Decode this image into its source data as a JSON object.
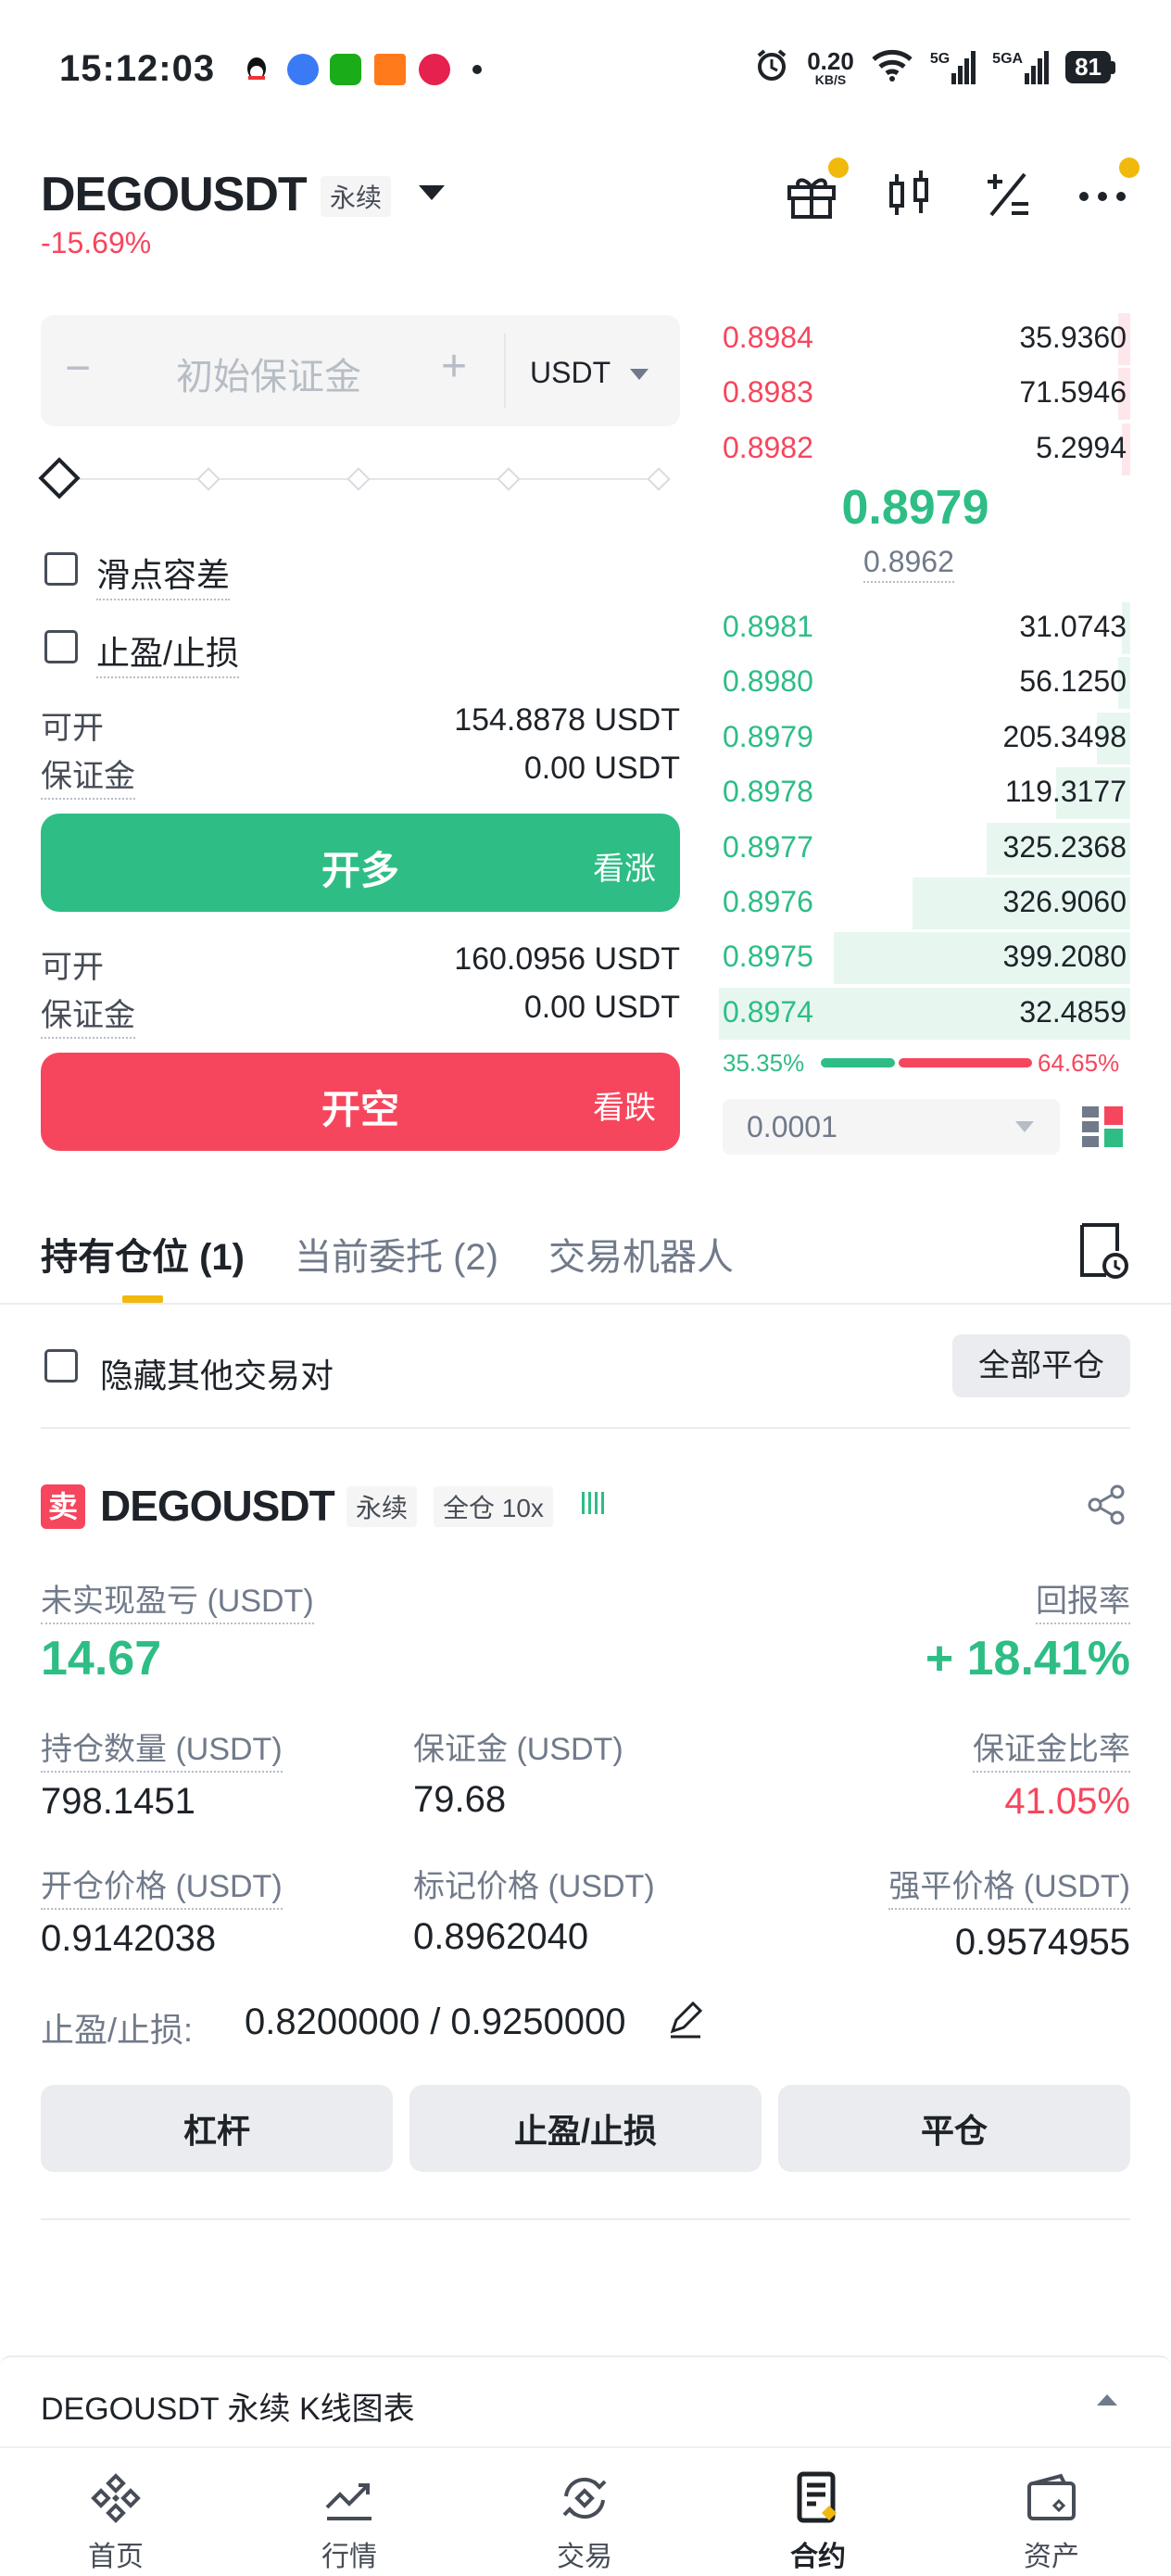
{
  "status_bar": {
    "time": "15:12:03",
    "speed_value": "0.20",
    "speed_unit": "KB/S",
    "net1": "5G",
    "net2": "5GA",
    "battery": "81"
  },
  "header": {
    "pair": "DEGOUSDT",
    "perp_tag": "永续",
    "change": "-15.69%"
  },
  "order_form": {
    "margin_placeholder": "初始保证金",
    "minus": "−",
    "plus": "+",
    "currency": "USDT",
    "slippage_label": "滑点容差",
    "tpsl_label": "止盈/止损",
    "long": {
      "available_label": "可开",
      "available_value": "154.8878 USDT",
      "margin_label": "保证金",
      "margin_value": "0.00 USDT",
      "button_label": "开多",
      "button_sub": "看涨"
    },
    "short": {
      "available_label": "可开",
      "available_value": "160.0956 USDT",
      "margin_label": "保证金",
      "margin_value": "0.00 USDT",
      "button_label": "开空",
      "button_sub": "看跌"
    }
  },
  "order_book": {
    "asks": [
      {
        "price": "0.8984",
        "qty": "35.9360",
        "depth": 0.03
      },
      {
        "price": "0.8983",
        "qty": "71.5946",
        "depth": 0.03
      },
      {
        "price": "0.8982",
        "qty": "5.2994",
        "depth": 0.02
      }
    ],
    "last_price": "0.8979",
    "mark_price": "0.8962",
    "bids": [
      {
        "price": "0.8981",
        "qty": "31.0743",
        "depth": 0.02
      },
      {
        "price": "0.8980",
        "qty": "56.1250",
        "depth": 0.03
      },
      {
        "price": "0.8979",
        "qty": "205.3498",
        "depth": 0.08
      },
      {
        "price": "0.8978",
        "qty": "119.3177",
        "depth": 0.18
      },
      {
        "price": "0.8977",
        "qty": "325.2368",
        "depth": 0.35
      },
      {
        "price": "0.8976",
        "qty": "326.9060",
        "depth": 0.53
      },
      {
        "price": "0.8975",
        "qty": "399.2080",
        "depth": 0.72
      },
      {
        "price": "0.8974",
        "qty": "32.4859",
        "depth": 1.0
      }
    ],
    "buy_ratio": "35.35%",
    "sell_ratio": "64.65%",
    "buy_ratio_value": 35.35,
    "precision": "0.0001"
  },
  "tabs": {
    "positions": "持有仓位 (1)",
    "orders": "当前委托 (2)",
    "bots": "交易机器人"
  },
  "filter": {
    "hide_other": "隐藏其他交易对",
    "close_all": "全部平仓"
  },
  "position": {
    "side": "卖",
    "symbol": "DEGOUSDT",
    "perp_tag": "永续",
    "mode_tag": "全仓 10x",
    "unrealized_label": "未实现盈亏 (USDT)",
    "unrealized_value": "14.67",
    "roe_label": "回报率",
    "roe_value": "+ 18.41%",
    "size_label": "持仓数量 (USDT)",
    "size_value": "798.1451",
    "margin_label": "保证金 (USDT)",
    "margin_value": "79.68",
    "margin_ratio_label": "保证金比率",
    "margin_ratio_value": "41.05%",
    "entry_label": "开仓价格 (USDT)",
    "entry_value": "0.9142038",
    "mark_label": "标记价格 (USDT)",
    "mark_value": "0.8962040",
    "liq_label": "强平价格 (USDT)",
    "liq_value": "0.9574955",
    "tpsl_label": "止盈/止损:",
    "tpsl_value": "0.8200000 / 0.9250000",
    "btn_leverage": "杠杆",
    "btn_tpsl": "止盈/止损",
    "btn_close": "平仓"
  },
  "kline_bar": {
    "label": "DEGOUSDT 永续 K线图表"
  },
  "nav": {
    "home": "首页",
    "markets": "行情",
    "trade": "交易",
    "futures": "合约",
    "assets": "资产"
  },
  "colors": {
    "green": "#2ebd85",
    "red": "#f6465d",
    "accent": "#f0b90b"
  }
}
